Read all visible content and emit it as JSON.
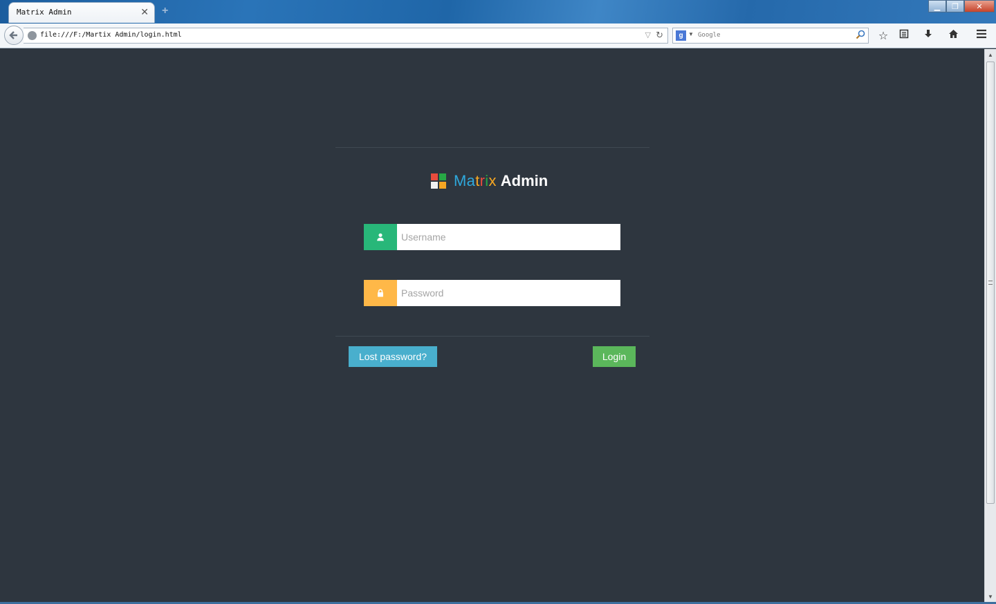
{
  "browser": {
    "tab_title": "Matrix Admin",
    "url": "file:///F:/Martix Admin/login.html",
    "search_engine": "Google",
    "search_placeholder": "Google"
  },
  "logo": {
    "brand_first": "Matrix",
    "brand_second": "Admin",
    "colors": {
      "red": "#e84c3d",
      "green": "#27a845",
      "white": "#f1f1f1",
      "orange": "#f5a623",
      "matrix_text": "#2ea9dd"
    }
  },
  "form": {
    "username_placeholder": "Username",
    "password_placeholder": "Password",
    "lost_password_label": "Lost password?",
    "login_label": "Login",
    "user_icon": "user-icon",
    "lock_icon": "lock-icon"
  },
  "colors": {
    "page_bg": "#2e363f",
    "username_addon": "#28b779",
    "password_addon": "#ffb848",
    "lost_button": "#49afcd",
    "login_button": "#5bb75b"
  }
}
